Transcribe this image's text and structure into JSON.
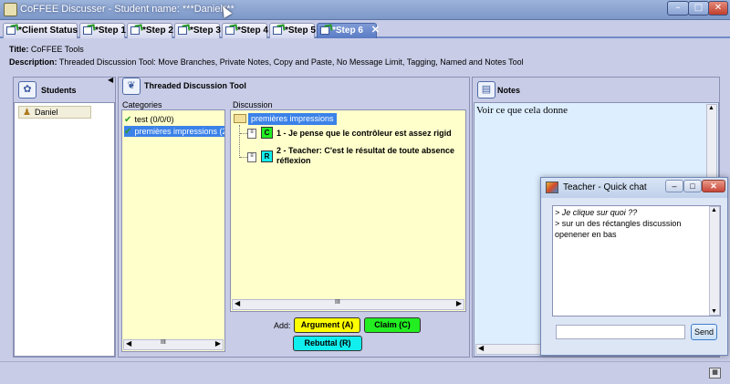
{
  "window": {
    "title": "CoFFEE Discusser - Student name: ***Daniel***",
    "min": "–",
    "max": "□",
    "close": "✕"
  },
  "tabs": [
    {
      "label": "*Client Status"
    },
    {
      "label": "*Step 1"
    },
    {
      "label": "*Step 2"
    },
    {
      "label": "*Step 3"
    },
    {
      "label": "*Step 4"
    },
    {
      "label": "*Step 5"
    },
    {
      "label": "*Step 6",
      "close": "✕"
    }
  ],
  "step": {
    "title_label": "Title:",
    "title": "CoFFEE Tools",
    "description_label": "Description:",
    "description": "Threaded Discussion Tool: Move Branches, Private Notes, Copy and Paste, No Message Limit, Tagging, Named and  Notes Tool"
  },
  "students": {
    "header": "Students",
    "collapse": "◀",
    "items": [
      {
        "name": "Daniel"
      }
    ]
  },
  "discussion_tool": {
    "header": "Threaded Discussion Tool",
    "categories_label": "Categories",
    "categories": [
      {
        "label": "test (0/0/0)"
      },
      {
        "label": "premières impressions (2"
      }
    ],
    "discussion_label": "Discussion",
    "root": "premières impressions",
    "messages": [
      {
        "tag": "C",
        "text": "1 - Je pense que le contrôleur est assez rigid"
      },
      {
        "tag": "R",
        "text": "2 - Teacher: C'est le résultat de toute absence",
        "text2": "réflexion"
      }
    ],
    "add_label": "Add:",
    "buttons": {
      "argument": "Argument (A)",
      "claim": "Claim (C)",
      "rebuttal": "Rebuttal (R)"
    },
    "scroll_mark": "III"
  },
  "notes": {
    "header": "Notes",
    "text": "Voir ce que cela donne"
  },
  "quick_chat": {
    "title": "Teacher - Quick chat",
    "lines": [
      {
        "text": "> Je clique sur quoi ??",
        "italic": true
      },
      {
        "text": "> sur un des réctangles discussion",
        "italic": false
      },
      {
        "text": "openener en bas",
        "italic": false
      }
    ],
    "input_value": "",
    "send_label": "Send"
  },
  "colors": {
    "argument": "#ffff00",
    "claim": "#22ee22",
    "rebuttal": "#11eeee",
    "selection": "#3b82e8",
    "panel_bg": "#c8cce6",
    "list_bg": "#ffffcc",
    "notes_bg": "#ddeeff"
  }
}
